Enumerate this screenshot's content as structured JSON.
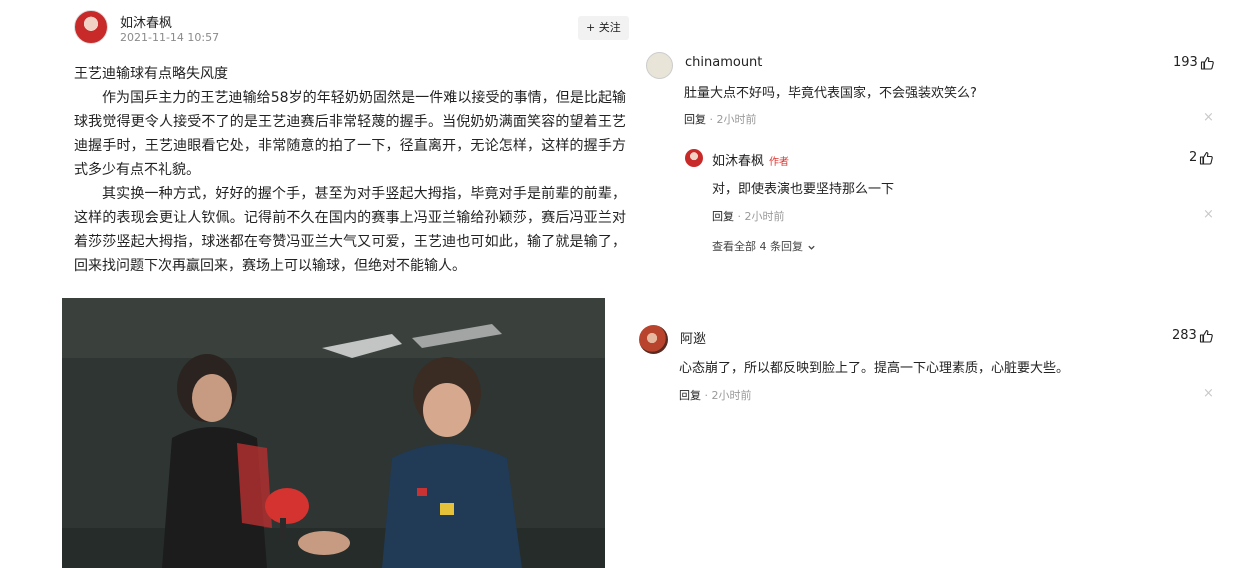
{
  "author": {
    "name": "如沐春枫",
    "time": "2021-11-14 10:57",
    "follow_label": "+ 关注"
  },
  "article": {
    "title": "王艺迪输球有点略失风度",
    "paragraphs": [
      "作为国乒主力的王艺迪输给58岁的年轻奶奶固然是一件难以接受的事情，但是比起输球我觉得更令人接受不了的是王艺迪赛后非常轻蔑的握手。当倪奶奶满面笑容的望着王艺迪握手时，王艺迪眼看它处，非常随意的拍了一下，径直离开，无论怎样，这样的握手方式多少有点不礼貌。",
      "其实换一种方式，好好的握个手，甚至为对手竖起大拇指，毕竟对手是前辈的前辈，这样的表现会更让人钦佩。记得前不久在国内的赛事上冯亚兰输给孙颖莎，赛后冯亚兰对着莎莎竖起大拇指，球迷都在夸赞冯亚兰大气又可爱，王艺迪也可如此，输了就是输了，回来找问题下次再赢回来，赛场上可以输球，但绝对不能输人。"
    ]
  },
  "comments": [
    {
      "user": "chinamount",
      "text": "肚量大点不好吗，毕竟代表国家，不会强装欢笑么?",
      "likes": "193",
      "reply_label": "回复",
      "time": "2小时前",
      "replies": [
        {
          "user": "如沐春枫",
          "badge": "作者",
          "text": "对，即使表演也要坚持那么一下",
          "likes": "2",
          "reply_label": "回复",
          "time": "2小时前"
        }
      ],
      "view_all_label": "查看全部 4 条回复"
    },
    {
      "user": "阿逖",
      "text": "心态崩了，所以都反映到脸上了。提高一下心理素质，心脏要大些。",
      "likes": "283",
      "reply_label": "回复",
      "time": "2小时前"
    }
  ],
  "icons": {
    "like": "thumbs-up-icon",
    "close": "close-icon",
    "chevron": "chevron-down-icon"
  },
  "colors": {
    "author_badge": "#e0332e",
    "time_gray": "#9a9a9a",
    "follow_bg": "#f2f2f2"
  }
}
